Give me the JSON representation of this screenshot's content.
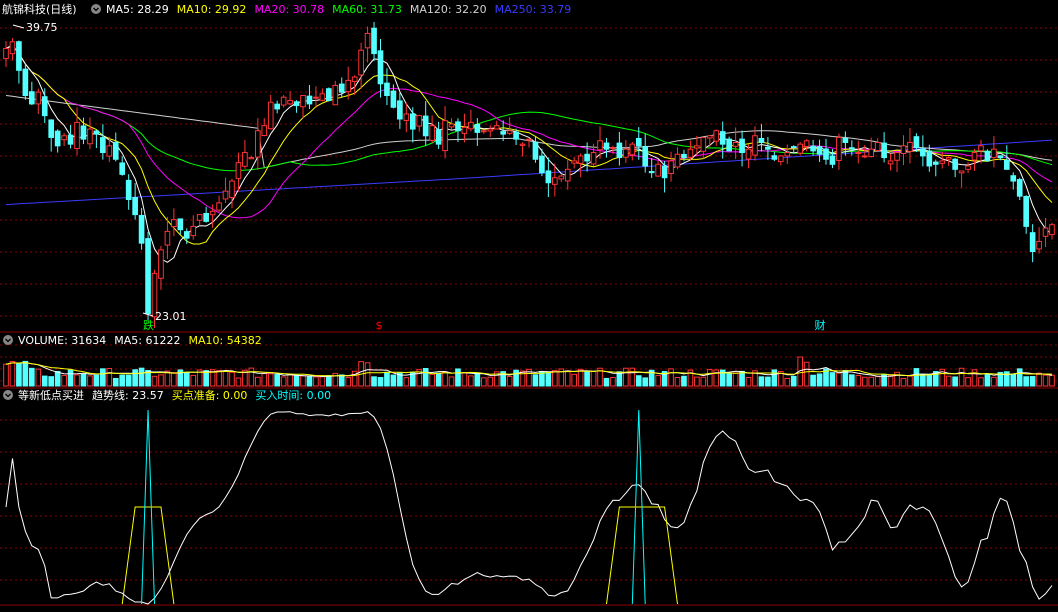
{
  "header": {
    "title": "航锦科技(日线)",
    "ma_items": [
      {
        "label": "MA5: 28.29",
        "color": "#ffffff"
      },
      {
        "label": "MA10: 29.92",
        "color": "#ffff00"
      },
      {
        "label": "MA20: 30.78",
        "color": "#ff00ff"
      },
      {
        "label": "MA60: 31.73",
        "color": "#00ff00"
      },
      {
        "label": "MA120: 32.20",
        "color": "#d0d0d0"
      },
      {
        "label": "MA250: 33.79",
        "color": "#3b3bff"
      }
    ]
  },
  "price_panel": {
    "high_label": "39.75",
    "low_label": "23.01",
    "markers": [
      {
        "text": "跌",
        "color": "#00ff00",
        "index": 22
      },
      {
        "text": "$",
        "color": "#ff0000",
        "index": 58
      },
      {
        "text": "财",
        "color": "#00ffff",
        "index": 126
      }
    ]
  },
  "volume_header": {
    "items": [
      {
        "label": "VOLUME: 31634",
        "color": "#ffffff"
      },
      {
        "label": "MA5: 61222",
        "color": "#ffffff"
      },
      {
        "label": "MA10: 54382",
        "color": "#ffff00"
      }
    ]
  },
  "indicator_header": {
    "items": [
      {
        "label": "等新低点买进",
        "color": "#ffffff"
      },
      {
        "label": "趋势线: 23.57",
        "color": "#ffffff"
      },
      {
        "label": "买点准备: 0.00",
        "color": "#ffff00"
      },
      {
        "label": "买入时间: 0.00",
        "color": "#00ffff"
      }
    ]
  },
  "colors": {
    "up": "#ff3333",
    "down": "#54ffff",
    "grid": "#8b0000",
    "ma5": "#ffffff",
    "ma10": "#ffff00",
    "ma20": "#ff00ff",
    "ma60": "#00ff00",
    "ma120": "#d0d0d0",
    "ma250": "#3b3bff"
  },
  "chart_data": {
    "type": "candlestick",
    "title": "航锦科技(日线)",
    "price_range": [
      22.5,
      40.5
    ],
    "close": [
      38.8,
      39.2,
      37.5,
      36.0,
      35.5,
      36.2,
      34.8,
      33.5,
      33.0,
      33.6,
      33.1,
      34.4,
      33.4,
      34.0,
      33.7,
      32.6,
      33.0,
      32.2,
      31.3,
      29.8,
      28.9,
      27.2,
      23.0,
      25.4,
      26.8,
      27.9,
      28.6,
      28.0,
      27.5,
      28.2,
      28.9,
      28.5,
      29.1,
      29.6,
      30.3,
      30.9,
      32.0,
      32.6,
      32.3,
      33.9,
      34.2,
      35.6,
      35.2,
      35.9,
      35.7,
      35.4,
      36.0,
      35.5,
      35.9,
      36.1,
      35.7,
      36.6,
      36.2,
      36.9,
      37.1,
      38.7,
      39.7,
      38.5,
      36.7,
      36.0,
      35.3,
      34.6,
      34.9,
      34.0,
      34.8,
      33.6,
      34.2,
      33.1,
      34.5,
      34.3,
      33.9,
      34.1,
      34.4,
      33.8,
      33.9,
      34.0,
      34.2,
      33.7,
      33.9,
      33.4,
      33.1,
      33.4,
      32.2,
      31.4,
      30.8,
      31.1,
      31.2,
      31.6,
      32.1,
      32.4,
      32.1,
      32.6,
      33.3,
      32.8,
      32.9,
      32.3,
      32.8,
      33.1,
      33.0,
      31.8,
      31.4,
      31.9,
      31.1,
      32.1,
      32.5,
      32.3,
      32.8,
      33.0,
      33.5,
      33.6,
      33.9,
      33.1,
      32.7,
      33.2,
      32.6,
      32.8,
      33.6,
      33.2,
      32.8,
      32.2,
      32.4,
      32.6,
      32.9,
      33.1,
      33.3,
      32.7,
      32.5,
      32.2,
      31.9,
      33.5,
      33.2,
      32.8,
      32.6,
      32.4,
      32.8,
      33.2,
      32.3,
      32.1,
      32.6,
      33.0,
      33.2,
      32.9,
      32.4,
      31.8,
      31.9,
      32.1,
      32.3,
      31.6,
      31.5,
      31.8,
      32.6,
      33.0,
      32.1,
      32.8,
      32.3,
      31.6,
      30.9,
      30.0,
      28.2,
      26.7,
      27.3,
      28.1,
      28.3
    ],
    "volume_max": 120000,
    "trend_line_range": [
      0,
      100
    ]
  }
}
